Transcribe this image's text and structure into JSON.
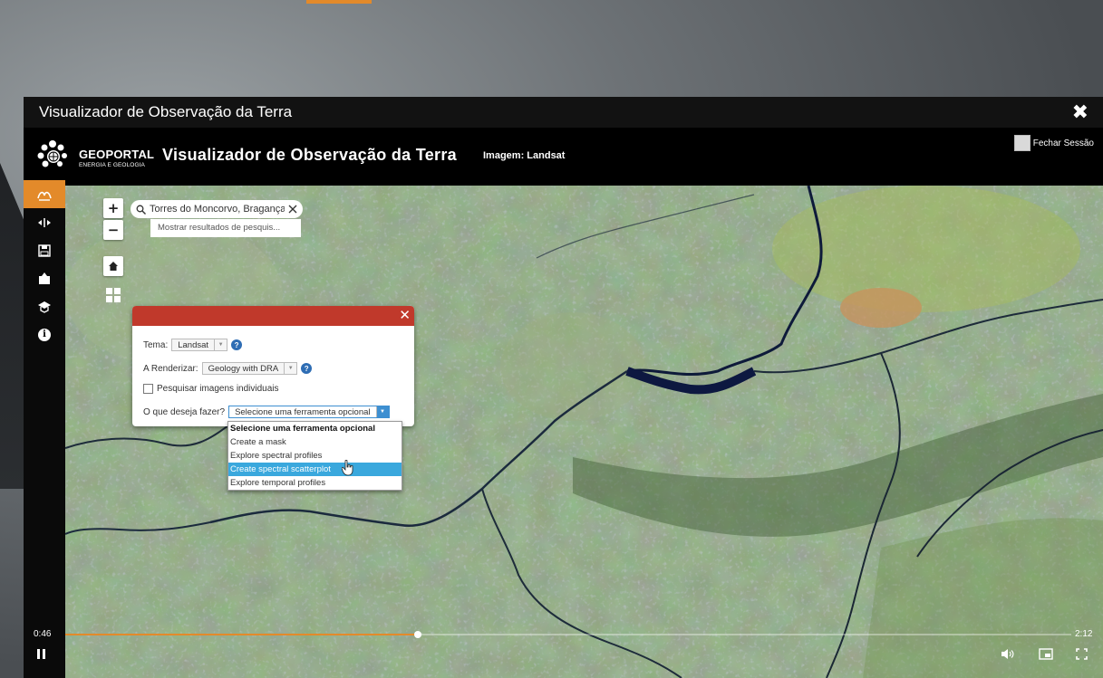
{
  "window": {
    "title": "Visualizador de Observação da Terra",
    "close_symbol": "✖"
  },
  "header": {
    "logo_line1": "GEOPORTAL",
    "logo_line2": "ENERGIA E GEOLOGIA",
    "title": "Visualizador de Observação da Terra",
    "subtitle": "Imagem: Landsat",
    "logout_label": "Fechar Sessão"
  },
  "toolbar": {
    "items": [
      "layers-icon",
      "swipe-icon",
      "save-icon",
      "export-icon",
      "education-icon",
      "info-icon"
    ]
  },
  "map": {
    "zoom_in": "+",
    "zoom_out": "−",
    "search_value": "Torres do Moncorvo, Bragança,",
    "search_results": "Mostrar resultados de pesquis..."
  },
  "panel": {
    "tema_label": "Tema:",
    "tema_value": "Landsat",
    "render_label": "A Renderizar:",
    "render_value": "Geology with DRA",
    "checkbox_label": "Pesquisar imagens individuais",
    "task_label": "O que deseja fazer?",
    "task_value": "Selecione uma ferramenta opcional",
    "options": [
      "Selecione uma ferramenta opcional",
      "Create a mask",
      "Explore spectral profiles",
      "Create spectral scatterplot",
      "Explore temporal profiles"
    ],
    "highlighted_option": "Create spectral scatterplot"
  },
  "video": {
    "current_time": "0:46",
    "duration": "2:12",
    "progress": 0.35
  },
  "colors": {
    "accent": "#e38a2a",
    "panel_header": "#c0392b",
    "dropdown_highlight": "#3aa8dd"
  }
}
